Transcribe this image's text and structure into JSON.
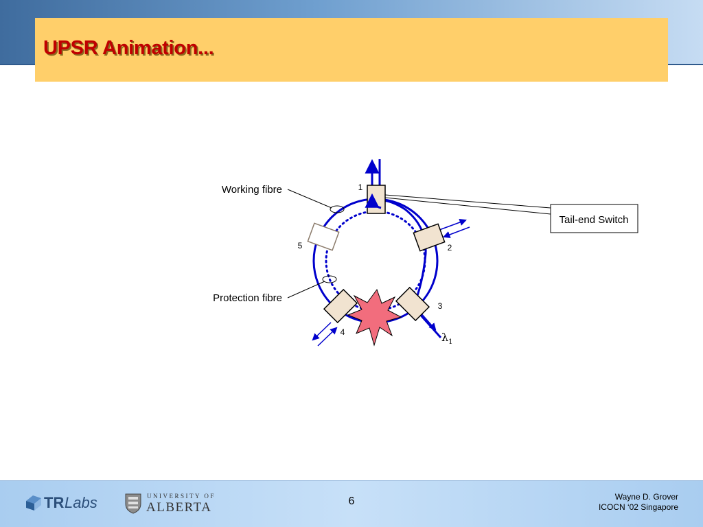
{
  "slide": {
    "title": "UPSR Animation...",
    "page_number": "6"
  },
  "diagram": {
    "labels": {
      "working_fibre": "Working fibre",
      "protection_fibre": "Protection fibre",
      "tail_end_switch": "Tail-end Switch",
      "wavelength_symbol": "λ",
      "wavelength_subscript": "1"
    },
    "nodes": [
      {
        "id": "1"
      },
      {
        "id": "2"
      },
      {
        "id": "3"
      },
      {
        "id": "4"
      },
      {
        "id": "5"
      }
    ]
  },
  "footer": {
    "author": "Wayne D. Grover",
    "venue": "ICOCN ‘02 Singapore",
    "logo_trlabs_tr": "TR",
    "logo_trlabs_labs": "Labs",
    "logo_alberta_university": "UNIVERSITY OF",
    "logo_alberta_name": "ALBERTA"
  },
  "colors": {
    "title_text": "#c00000",
    "title_box": "#ffcf6a",
    "fibre": "#0000cc",
    "node_fill": "#f1e3d0",
    "failure_fill": "#f26d7d"
  }
}
